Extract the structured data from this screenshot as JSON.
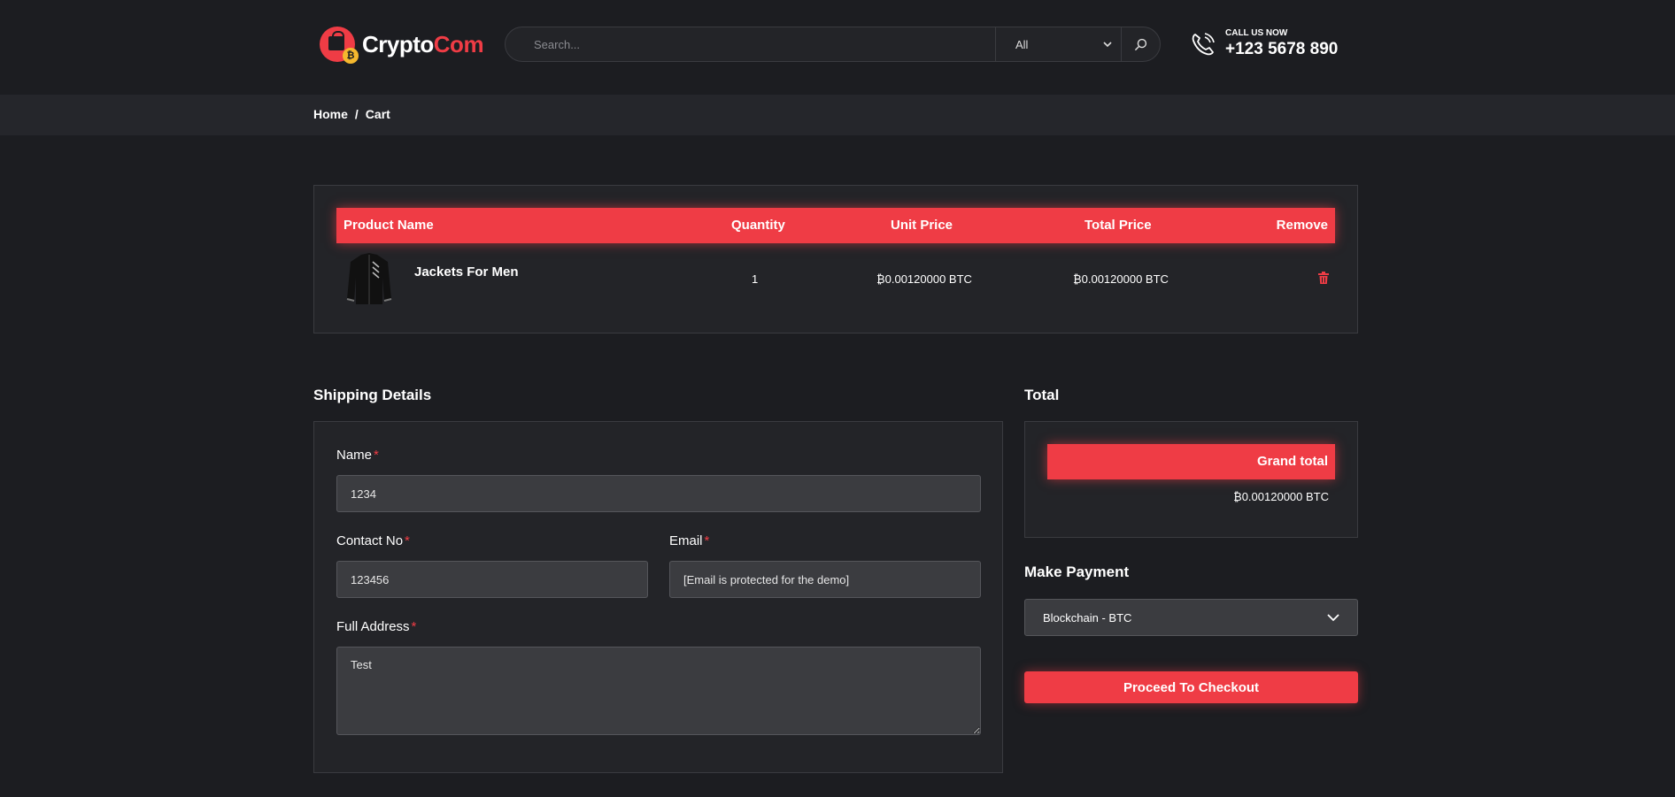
{
  "header": {
    "logo": {
      "part1": "Crypto",
      "part2": "Com",
      "badge_glyph": "₿"
    },
    "search": {
      "placeholder": "Search...",
      "category": "All"
    },
    "call": {
      "label": "CALL US NOW",
      "number": "+123 5678 890"
    }
  },
  "breadcrumb": {
    "home": "Home",
    "separator": "/",
    "current": "Cart"
  },
  "cart": {
    "columns": {
      "product": "Product Name",
      "quantity": "Quantity",
      "unit_price": "Unit Price",
      "total_price": "Total Price",
      "remove": "Remove"
    },
    "items": [
      {
        "name": "Jackets For Men",
        "quantity": "1",
        "unit_price": "₿0.00120000 BTC",
        "total_price": "₿0.00120000 BTC"
      }
    ]
  },
  "shipping": {
    "title": "Shipping Details",
    "name_label": "Name",
    "name_value": "1234",
    "contact_label": "Contact No",
    "contact_value": "123456",
    "email_label": "Email",
    "email_value": "[Email is protected for the demo]",
    "address_label": "Full Address",
    "address_value": "Test",
    "required_mark": "*"
  },
  "total": {
    "title": "Total",
    "grand_total_label": "Grand total",
    "grand_total_value": "₿0.00120000 BTC"
  },
  "payment": {
    "title": "Make Payment",
    "selected": "Blockchain - BTC"
  },
  "checkout_label": "Proceed To Checkout",
  "colors": {
    "accent": "#ef3c45",
    "background": "#1c1d21",
    "panel": "#232428",
    "field": "#3b3c40"
  }
}
